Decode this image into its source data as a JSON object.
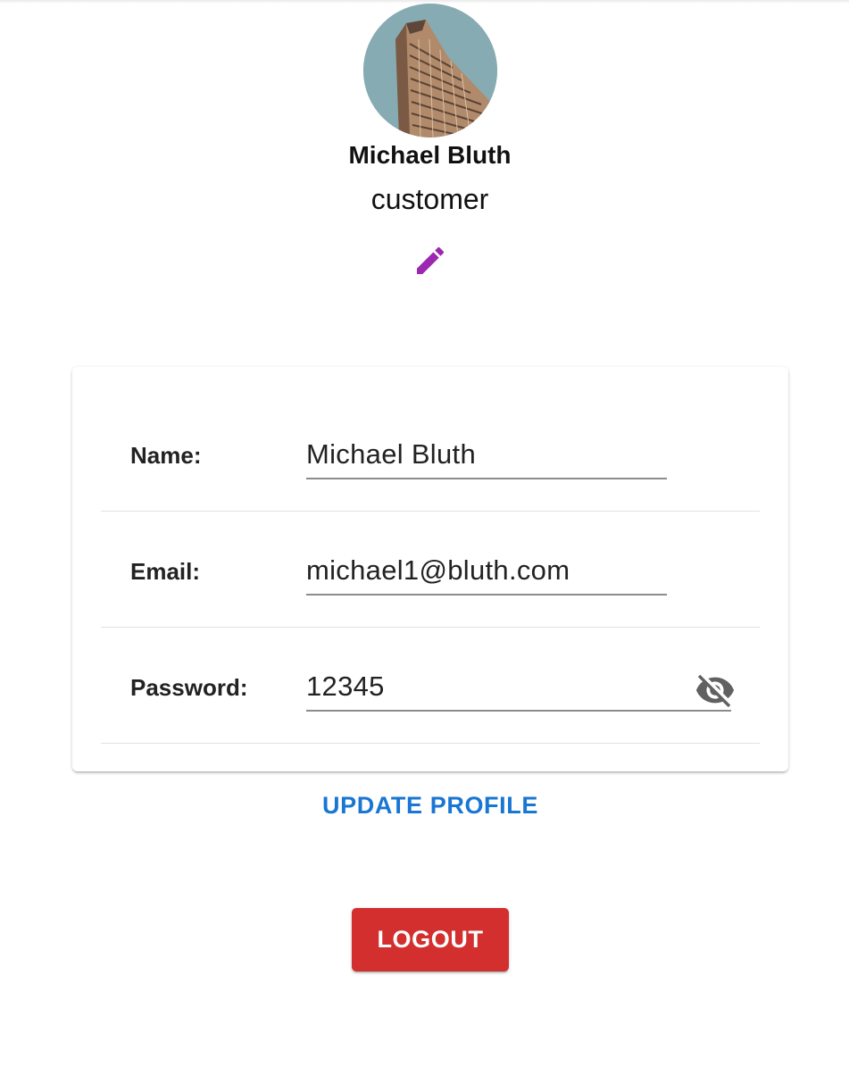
{
  "profile": {
    "name": "Michael Bluth",
    "role": "customer",
    "avatar_icon": "building-photo",
    "edit_icon": "pencil-icon"
  },
  "form": {
    "name_label": "Name:",
    "name_value": "Michael Bluth",
    "email_label": "Email:",
    "email_value": "michael1@bluth.com",
    "password_label": "Password:",
    "password_value": "12345",
    "visibility_icon": "eye-off-icon"
  },
  "actions": {
    "update_label": "UPDATE PROFILE",
    "logout_label": "LOGOUT"
  },
  "colors": {
    "edit_icon": "#9c27b0",
    "update_text": "#1976d2",
    "logout_bg": "#d32f2f"
  }
}
